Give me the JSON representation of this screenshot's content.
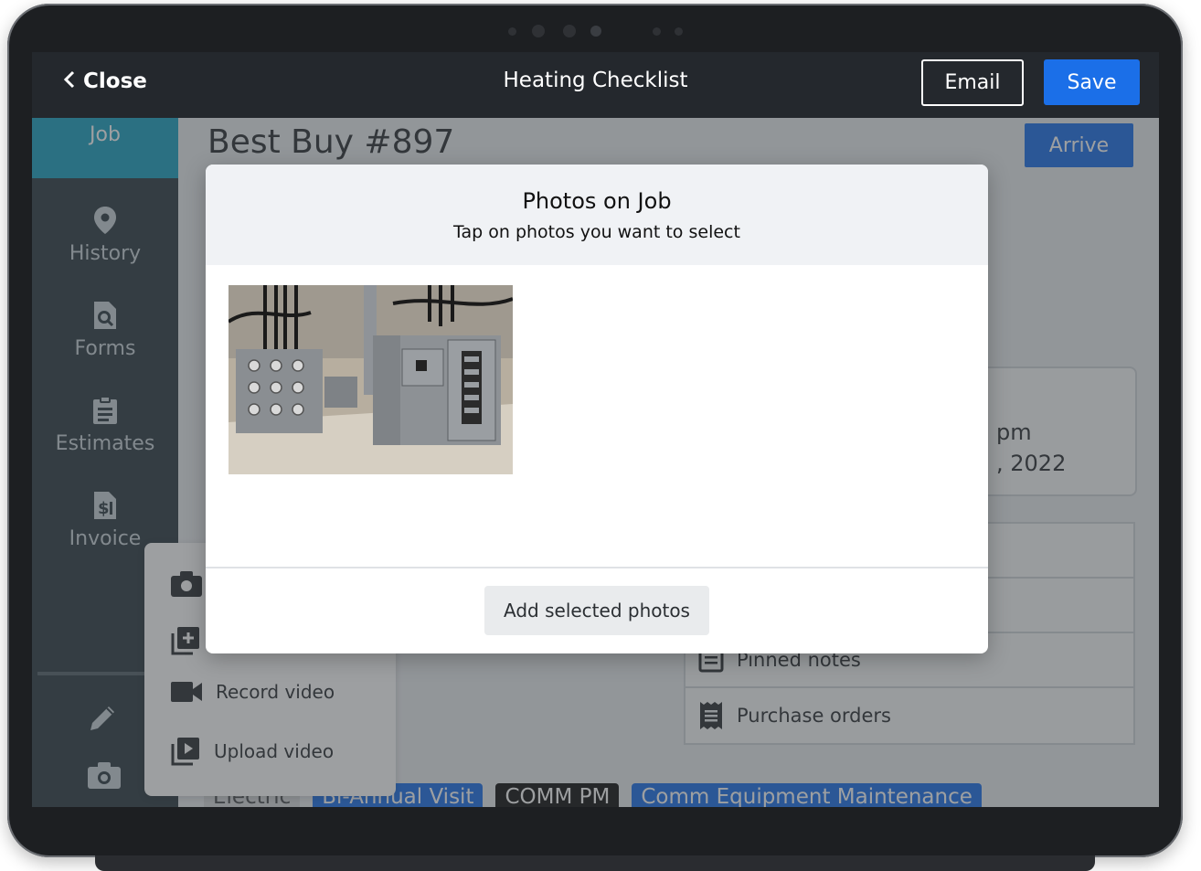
{
  "topbar": {
    "close_label": "Close",
    "title": "Heating Checklist",
    "email_label": "Email",
    "save_label": "Save"
  },
  "sidebar": {
    "job_label": "Job",
    "items": [
      {
        "label": "History",
        "icon": "map-pin-icon"
      },
      {
        "label": "Forms",
        "icon": "document-search-icon"
      },
      {
        "label": "Estimates",
        "icon": "clipboard-icon"
      },
      {
        "label": "Invoice",
        "icon": "invoice-dollar-icon"
      }
    ],
    "bottom_icons": [
      "pencil-icon",
      "camera-icon"
    ]
  },
  "main": {
    "job_title": "Best Buy #897",
    "arrive_label": "Arrive",
    "info_lines": [
      "pm",
      ", 2022"
    ],
    "links": [
      {
        "label": "",
        "icon": ""
      },
      {
        "label": "",
        "icon": ""
      },
      {
        "label": "Pinned notes",
        "icon": "notes-icon"
      },
      {
        "label": "Purchase orders",
        "icon": "receipt-icon"
      }
    ],
    "tags": [
      "Electric",
      "Bi-Annual Visit",
      "COMM PM",
      "Comm Equipment Maintenance"
    ]
  },
  "popover": {
    "items": [
      {
        "label": "",
        "icon": "camera-icon"
      },
      {
        "label": "",
        "icon": "add-photo-icon"
      },
      {
        "label": "Record video",
        "icon": "video-camera-icon"
      },
      {
        "label": "Upload video",
        "icon": "upload-video-icon"
      }
    ]
  },
  "modal": {
    "title": "Photos on Job",
    "subtitle": "Tap on photos you want to select",
    "add_button": "Add selected photos",
    "photo_count": 1
  },
  "colors": {
    "accent": "#1b6fe8",
    "topbar": "#24282d",
    "sidebar": "#2c3a42",
    "job_tab": "#1aa0c0"
  }
}
